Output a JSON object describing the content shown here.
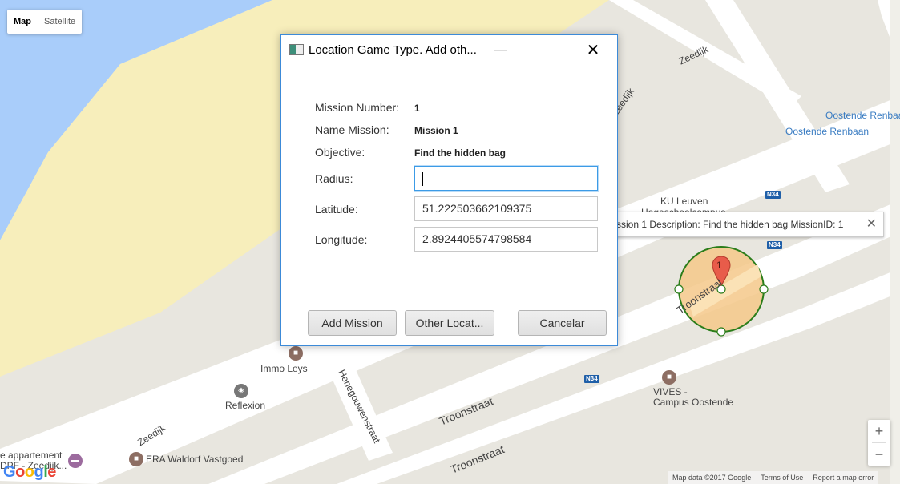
{
  "map": {
    "type_buttons": [
      "Map",
      "Satellite"
    ],
    "labels": {
      "zeedijk_top": "Zeedijk",
      "zeedijk_bottom": "Zeedijk",
      "zeedijk_mid": "Zeedijk",
      "oostende_renbaan_1": "Oostende Renbaan",
      "oostende_renbaan_2": "Oostende Renbaan",
      "ku_leuven_1": "KU Leuven",
      "ku_leuven_2": "Hogeschoolcampus",
      "troonstraat_circle": "Troonstraat",
      "troonstraat_1": "Troonstraat",
      "troonstraat_2": "Troonstraat",
      "henegouwenstraat": "Henegouwenstraat",
      "immo_leys": "Immo Leys",
      "reflexion": "Reflexion",
      "vives_1": "VIVES -",
      "vives_2": "Campus Oostende",
      "era": "ERA Waldorf Vastgoed",
      "appartement_1": "e appartement",
      "appartement_2": "DPF - Zeedijk..."
    },
    "shields": [
      "N34",
      "N34",
      "N34"
    ],
    "marker_number": "1",
    "info_window": "ssion 1 Description: Find the hidden bag MissionID: 1",
    "zoom_in": "+",
    "zoom_out": "−",
    "attribution": [
      "Map data ©2017 Google",
      "Terms of Use",
      "Report a map error"
    ],
    "logo": "Google",
    "colors": {
      "water": "#a9cdfa",
      "beach": "#f7eebb",
      "land": "#e8e6df",
      "circle_fill": "#f4c889",
      "circle_stroke": "#2b7d1a",
      "marker": "#e85c4a"
    }
  },
  "dialog": {
    "title": "Location Game Type. Add oth...",
    "controls": {
      "minimize": "—",
      "maximize": "",
      "close": "✕"
    },
    "mission_number_label": "Mission Number:",
    "mission_number_value": "1",
    "name_label": "Name Mission:",
    "name_value": "Mission 1",
    "objective_label": "Objective:",
    "objective_value": "Find the hidden bag",
    "radius_label": "Radius:",
    "radius_value": "",
    "latitude_label": "Latitude:",
    "latitude_value": "51.222503662109375",
    "longitude_label": "Longitude:",
    "longitude_value": "2.8924405574798584",
    "buttons": {
      "add": "Add Mission",
      "other": "Other Locat...",
      "cancel": "Cancelar"
    }
  }
}
